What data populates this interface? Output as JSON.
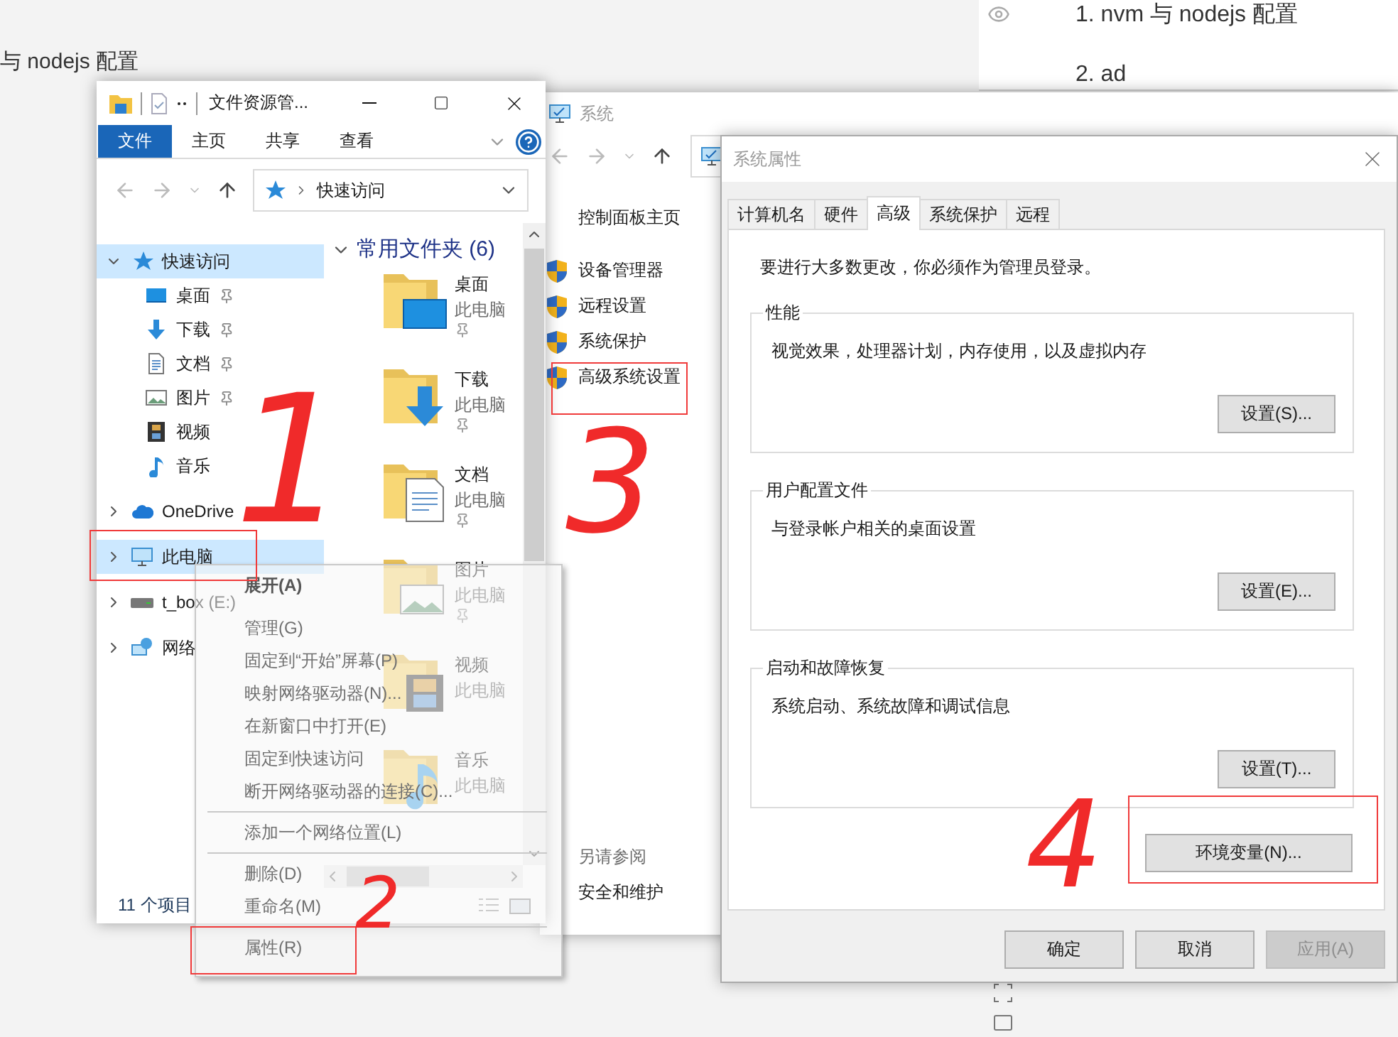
{
  "doc_heading": "与 nodejs 配置",
  "outline": [
    {
      "text": "1. nvm 与 nodejs 配置"
    },
    {
      "text": "2. ad"
    }
  ],
  "explorer": {
    "title": "文件资源管...",
    "ribbon_tabs": [
      {
        "label": "文件",
        "selected": true
      },
      {
        "label": "主页",
        "selected": false
      },
      {
        "label": "共享",
        "selected": false
      },
      {
        "label": "查看",
        "selected": false
      }
    ],
    "address": "快速访问",
    "nav": [
      {
        "label": "快速访问",
        "kind": "star",
        "selected": true,
        "expanded": true,
        "children": [
          {
            "label": "桌面",
            "kind": "desktop",
            "selected": false,
            "pinned": true
          },
          {
            "label": "下载",
            "kind": "download",
            "selected": false,
            "pinned": true
          },
          {
            "label": "文档",
            "kind": "document",
            "selected": false,
            "pinned": true
          },
          {
            "label": "图片",
            "kind": "pictures",
            "selected": false,
            "pinned": true
          },
          {
            "label": "视频",
            "kind": "videos",
            "selected": false,
            "pinned": false
          },
          {
            "label": "音乐",
            "kind": "music",
            "selected": false,
            "pinned": false
          }
        ]
      },
      {
        "label": "OneDrive",
        "kind": "cloud",
        "selected": false,
        "expanded": false
      },
      {
        "label": "此电脑",
        "kind": "pc",
        "selected": true,
        "expanded": false
      },
      {
        "label": "t_box (E:)",
        "kind": "drive",
        "selected": false,
        "expanded": false
      },
      {
        "label": "网络",
        "kind": "network",
        "selected": false,
        "expanded": false
      }
    ],
    "section": "常用文件夹 (6)",
    "folders": [
      {
        "name": "桌面",
        "location": "此电脑",
        "kind": "desktop",
        "pinned": true
      },
      {
        "name": "下载",
        "location": "此电脑",
        "kind": "download",
        "pinned": true
      },
      {
        "name": "文档",
        "location": "此电脑",
        "kind": "document",
        "pinned": true
      },
      {
        "name": "图片",
        "location": "此电脑",
        "kind": "pictures",
        "pinned": true
      },
      {
        "name": "视频",
        "location": "此电脑",
        "kind": "videos",
        "pinned": false
      },
      {
        "name": "音乐",
        "location": "此电脑",
        "kind": "music",
        "pinned": false
      }
    ],
    "status": "11 个项目"
  },
  "context_menu": {
    "groups": [
      {
        "items": [
          {
            "label": "展开(A)",
            "default": true
          },
          {
            "label": "管理(G)",
            "default": false
          },
          {
            "label": "固定到“开始”屏幕(P)",
            "default": false
          },
          {
            "label": "映射网络驱动器(N)...",
            "default": false
          },
          {
            "label": "在新窗口中打开(E)",
            "default": false
          },
          {
            "label": "固定到快速访问",
            "default": false
          },
          {
            "label": "断开网络驱动器的连接(C)...",
            "default": false
          }
        ]
      },
      {
        "items": [
          {
            "label": "添加一个网络位置(L)",
            "default": false
          }
        ]
      },
      {
        "items": [
          {
            "label": "删除(D)",
            "default": false
          },
          {
            "label": "重命名(M)",
            "default": false
          }
        ]
      },
      {
        "items": [
          {
            "label": "属性(R)",
            "default": false
          }
        ]
      }
    ]
  },
  "system_window": {
    "title": "系统",
    "home": "控制面板主页",
    "tasks": [
      "设备管理器",
      "远程设置",
      "系统保护",
      "高级系统设置"
    ],
    "see_also_heading": "另请参阅",
    "see_also": [
      "安全和维护"
    ]
  },
  "properties_dialog": {
    "title": "系统属性",
    "tabs": [
      {
        "label": "计算机名",
        "selected": false
      },
      {
        "label": "硬件",
        "selected": false
      },
      {
        "label": "高级",
        "selected": true
      },
      {
        "label": "系统保护",
        "selected": false
      },
      {
        "label": "远程",
        "selected": false
      }
    ],
    "notice": "要进行大多数更改，你必须作为管理员登录。",
    "groups": [
      {
        "title": "性能",
        "description": "视觉效果，处理器计划，内存使用，以及虚拟内存",
        "button": "设置(S)..."
      },
      {
        "title": "用户配置文件",
        "description": "与登录帐户相关的桌面设置",
        "button": "设置(E)..."
      },
      {
        "title": "启动和故障恢复",
        "description": "系统启动、系统故障和调试信息",
        "button": "设置(T)..."
      }
    ],
    "env_button": "环境变量(N)...",
    "footer_buttons": [
      {
        "label": "确定",
        "disabled": false
      },
      {
        "label": "取消",
        "disabled": false
      },
      {
        "label": "应用(A)",
        "disabled": true
      }
    ]
  },
  "annotations": [
    {
      "label": "1"
    },
    {
      "label": "2"
    },
    {
      "label": "3"
    },
    {
      "label": "4"
    }
  ]
}
